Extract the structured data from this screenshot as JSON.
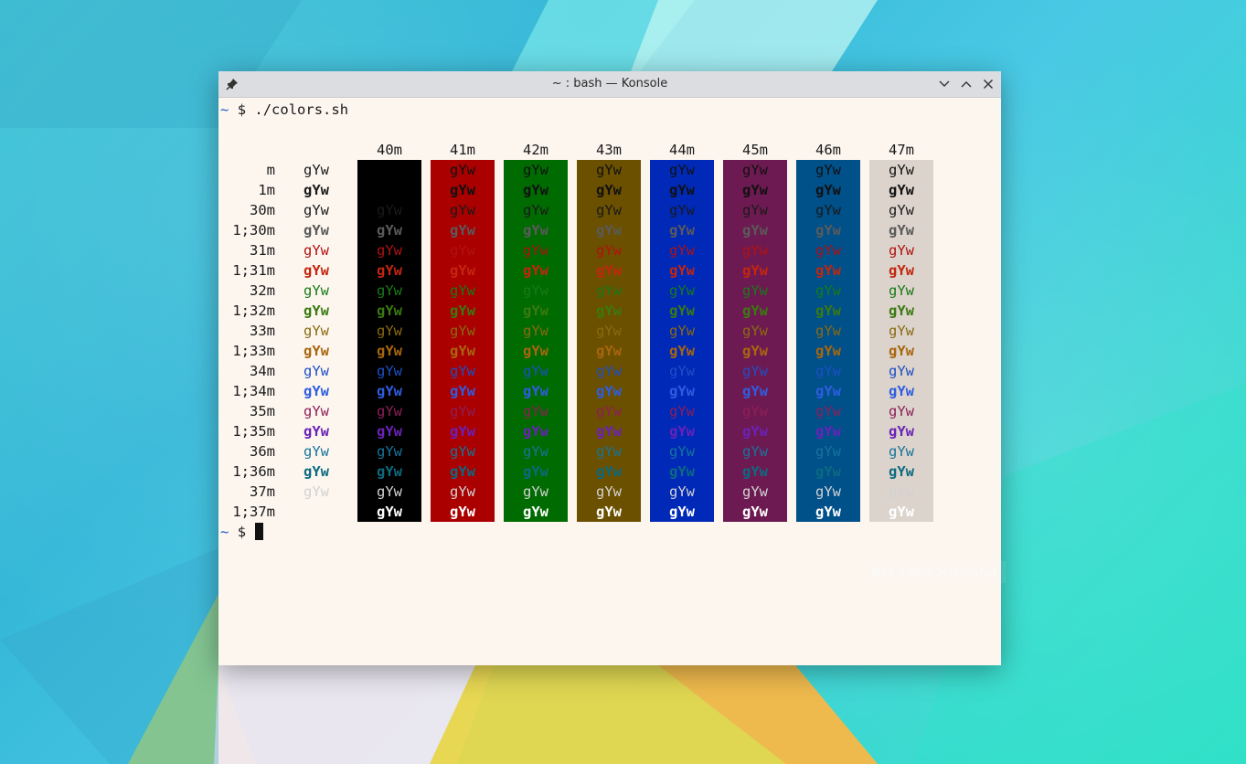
{
  "window": {
    "title": "~ : bash — Konsole"
  },
  "terminal": {
    "command_line": {
      "tilde": "~",
      "dollar": "$",
      "command": "./colors.sh"
    },
    "headers": [
      "40m",
      "41m",
      "42m",
      "43m",
      "44m",
      "45m",
      "46m",
      "47m"
    ],
    "row_labels": [
      "m",
      "1m",
      "30m",
      "1;30m",
      "31m",
      "1;31m",
      "32m",
      "1;32m",
      "33m",
      "1;33m",
      "34m",
      "1;34m",
      "35m",
      "1;35m",
      "36m",
      "1;36m",
      "37m",
      "1;37m"
    ],
    "sample_text": "gYw",
    "prompt": {
      "tilde": "~",
      "dollar": "$"
    }
  },
  "colors": {
    "backgrounds": [
      "#000000",
      "#aa0000",
      "#006b00",
      "#6b5000",
      "#0029b8",
      "#6e1a52",
      "#00508a",
      "#dcd4cc"
    ],
    "foregrounds": {
      "default": "#1a1a1a",
      "30": "#1a1a1a",
      "1;30": "#5a5a5a",
      "31": "#b01212",
      "1;31": "#c3260e",
      "32": "#187a18",
      "1;32": "#3a7a10",
      "33": "#8a6a10",
      "1;33": "#a8660e",
      "34": "#1d4fc4",
      "1;34": "#2f5de0",
      "35": "#8e1f58",
      "1;35": "#6a22b8",
      "36": "#16749a",
      "1;36": "#0c6a80",
      "37": "#d2d2d2",
      "1;37": "#ffffff"
    }
  },
  "overlay": {
    "toast_text": "Take a New Screenshot"
  }
}
